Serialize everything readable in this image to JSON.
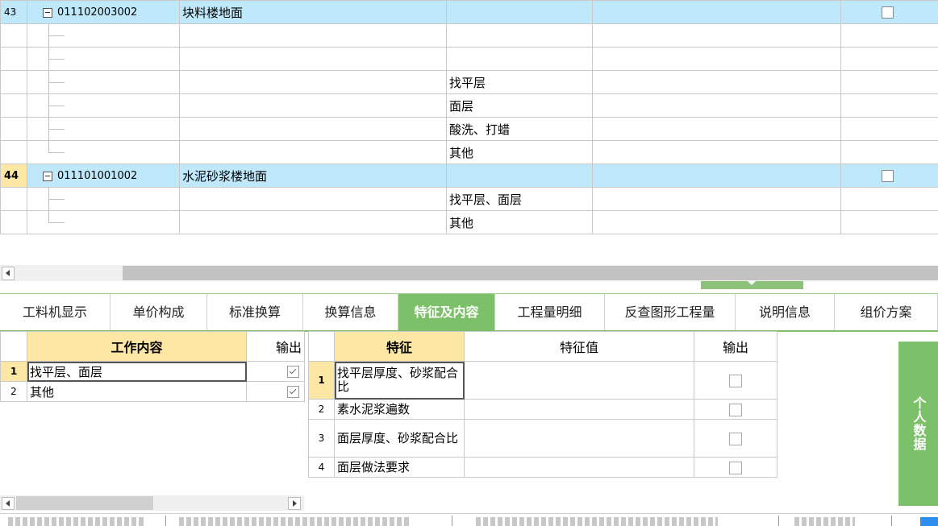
{
  "top_grid": {
    "rows": [
      {
        "type": "parent",
        "num": "43",
        "code": "011102003002",
        "name": "块料楼地面",
        "active": false
      },
      {
        "type": "child",
        "content": ""
      },
      {
        "type": "child",
        "content": ""
      },
      {
        "type": "child",
        "content": "找平层"
      },
      {
        "type": "child",
        "content": "面层"
      },
      {
        "type": "child",
        "content": "酸洗、打蜡"
      },
      {
        "type": "child",
        "content": "其他"
      },
      {
        "type": "parent",
        "num": "44",
        "code": "011101001002",
        "name": "水泥砂浆楼地面",
        "active": true
      },
      {
        "type": "child",
        "content": "找平层、面层"
      },
      {
        "type": "child",
        "content": "其他"
      }
    ]
  },
  "tabs": [
    {
      "label": "工料机显示",
      "active": false
    },
    {
      "label": "单价构成",
      "active": false
    },
    {
      "label": "标准换算",
      "active": false
    },
    {
      "label": "换算信息",
      "active": false
    },
    {
      "label": "特征及内容",
      "active": true
    },
    {
      "label": "工程量明细",
      "active": false
    },
    {
      "label": "反查图形工程量",
      "active": false
    },
    {
      "label": "说明信息",
      "active": false
    },
    {
      "label": "组价方案",
      "active": false
    }
  ],
  "work_panel": {
    "header_content": "工作内容",
    "header_output": "输出",
    "rows": [
      {
        "num": "1",
        "text": "找平层、面层",
        "checked": true,
        "selected": true
      },
      {
        "num": "2",
        "text": "其他",
        "checked": true,
        "selected": false
      }
    ]
  },
  "feature_panel": {
    "header_feature": "特征",
    "header_value": "特征值",
    "header_output": "输出",
    "rows": [
      {
        "num": "1",
        "name": "找平层厚度、砂浆配合比",
        "value": "",
        "checked": false,
        "selected": true,
        "tall": true
      },
      {
        "num": "2",
        "name": "素水泥浆遍数",
        "value": "",
        "checked": false,
        "selected": false,
        "tall": false
      },
      {
        "num": "3",
        "name": "面层厚度、砂浆配合比",
        "value": "",
        "checked": false,
        "selected": false,
        "tall": true
      },
      {
        "num": "4",
        "name": "面层做法要求",
        "value": "",
        "checked": false,
        "selected": false,
        "tall": false
      }
    ]
  },
  "side_tab": {
    "label": "个人数据"
  },
  "colors": {
    "accent": "#7cc06a",
    "header": "#fde7a5",
    "row_highlight": "#bfe9fb",
    "status_blue": "#2d8ef0"
  }
}
